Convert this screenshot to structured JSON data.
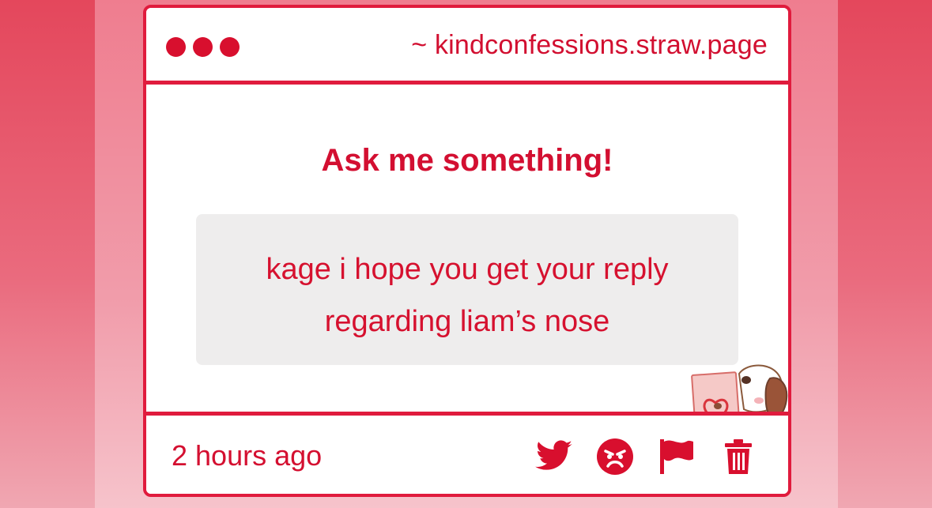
{
  "window": {
    "url": "~ kindconfessions.straw.page"
  },
  "prompt": {
    "title": "Ask me something!"
  },
  "message": {
    "line1": "kage i hope you get your reply",
    "line2": "regarding liam’s nose"
  },
  "footer": {
    "time": "2 hours ago",
    "actions": [
      {
        "icon": "twitter-icon"
      },
      {
        "icon": "angry-face-icon"
      },
      {
        "icon": "flag-icon"
      },
      {
        "icon": "trash-icon"
      }
    ]
  },
  "colors": {
    "accent": "#d80f2e",
    "background": "#e4475c",
    "message_box": "#eeeded"
  }
}
